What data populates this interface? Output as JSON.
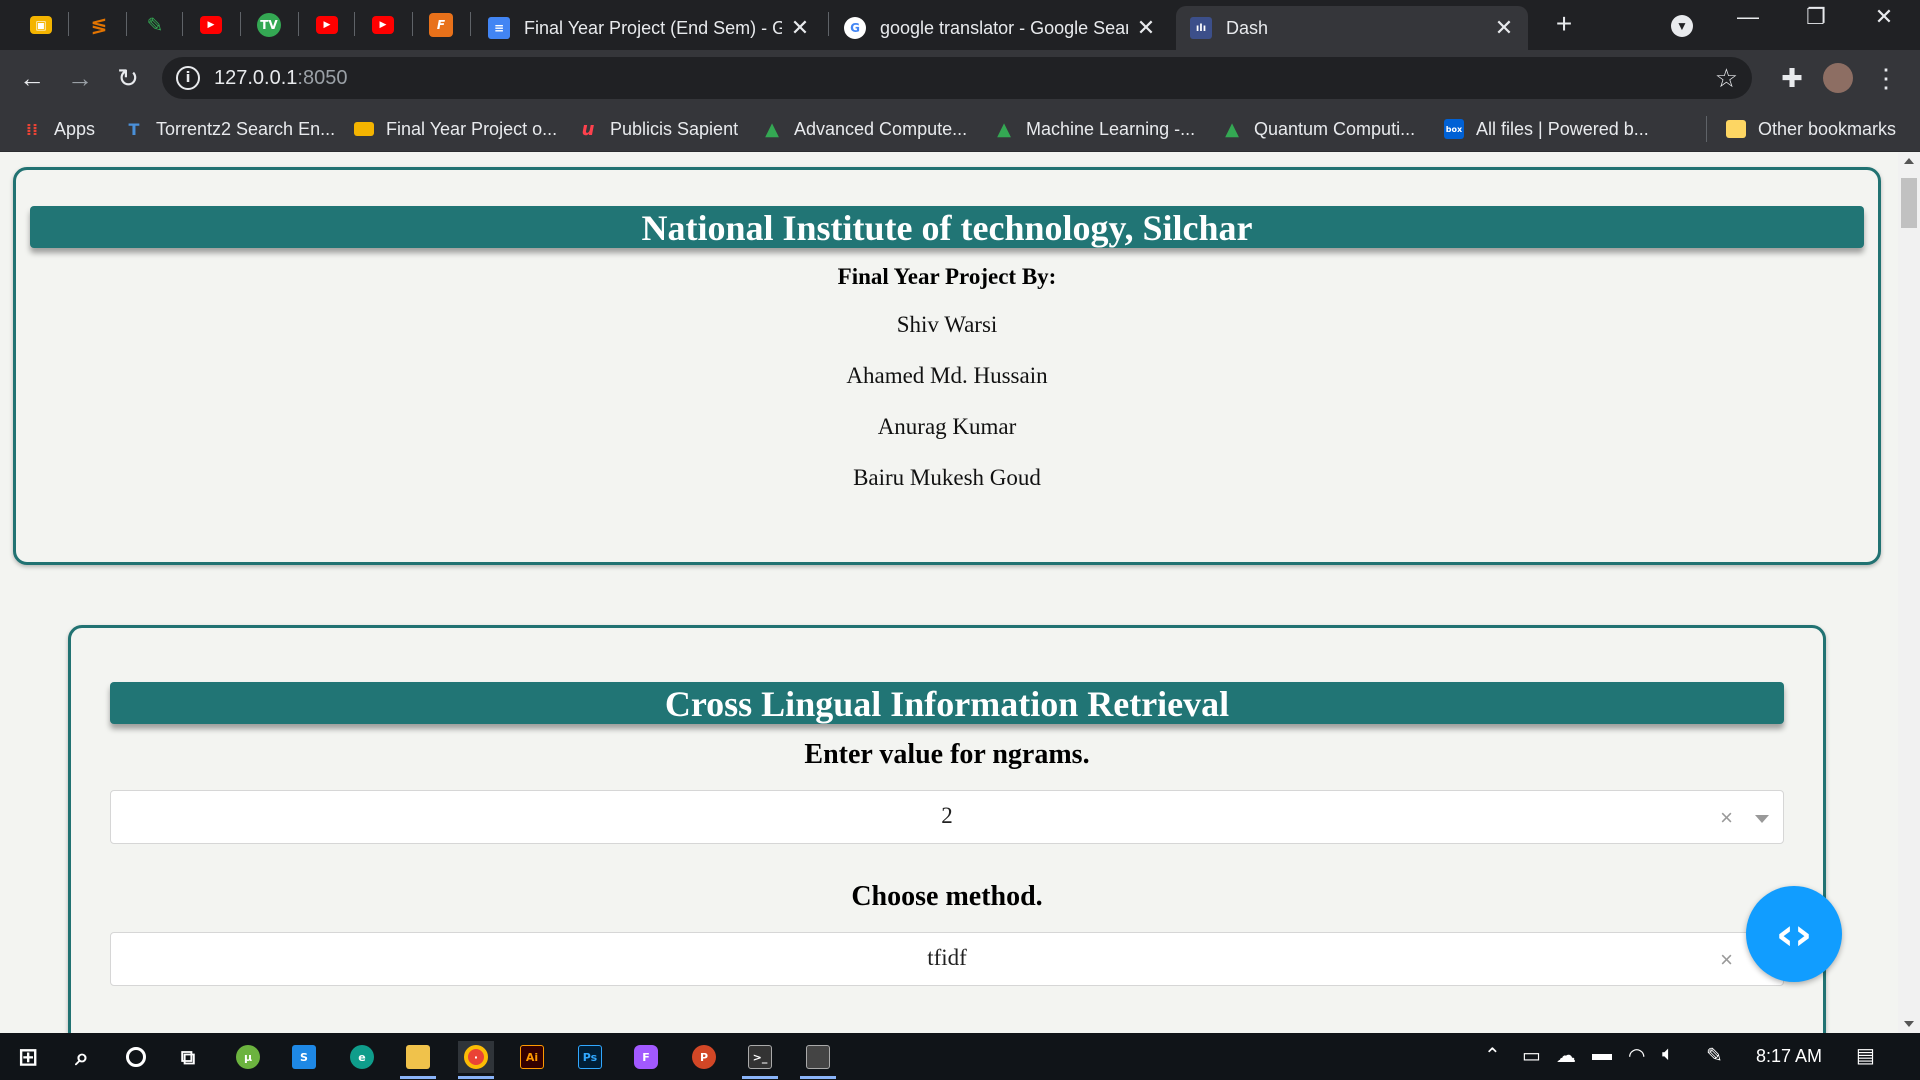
{
  "browser": {
    "pinned_tabs": [
      {
        "icon": "google-classroom-icon",
        "color": "#f4b400"
      },
      {
        "icon": "tempo-app-icon",
        "color": "#e37400"
      },
      {
        "icon": "feather-app-icon",
        "color": "#34a853"
      },
      {
        "icon": "youtube-icon",
        "color": "#ff0000"
      },
      {
        "icon": "tv-app-icon",
        "color": "#34a853"
      },
      {
        "icon": "youtube-icon",
        "color": "#ff0000"
      },
      {
        "icon": "youtube-icon",
        "color": "#ff0000"
      },
      {
        "icon": "fiverr-f-icon",
        "color": "#e8711a"
      }
    ],
    "tabs": [
      {
        "title": "Final Year Project (End Sem) - Go",
        "icon": "google-docs-icon",
        "close": "✕"
      },
      {
        "title": "google translator - Google Searc",
        "icon": "google-g-icon",
        "close": "✕"
      },
      {
        "title": "Dash",
        "icon": "dash-plotly-icon",
        "close": "✕",
        "active": true
      }
    ],
    "new_tab": "+",
    "window_controls": {
      "minimize": "—",
      "restore": "❐",
      "close": "✕"
    },
    "url_host": "127.0.0.1",
    "url_port": ":8050",
    "bookmarks": [
      {
        "label": "Apps",
        "icon": "apps-grid-icon"
      },
      {
        "label": "Torrentz2 Search En...",
        "icon": "torrentz-icon"
      },
      {
        "label": "Final Year Project o...",
        "icon": "google-slides-icon"
      },
      {
        "label": "Publicis Sapient",
        "icon": "publicis-sapient-icon"
      },
      {
        "label": "Advanced Compute...",
        "icon": "google-drive-icon"
      },
      {
        "label": "Machine Learning -...",
        "icon": "google-drive-icon"
      },
      {
        "label": "Quantum Computi...",
        "icon": "google-drive-icon"
      },
      {
        "label": "All files | Powered b...",
        "icon": "box-icon"
      }
    ],
    "other_bookmarks": "Other bookmarks"
  },
  "header_card": {
    "title": "National Institute of technology, Silchar",
    "subtitle": "Final Year Project By:",
    "members": [
      "Shiv Warsi",
      "Ahamed Md. Hussain",
      "Anurag Kumar",
      "Bairu Mukesh Goud"
    ]
  },
  "clir_card": {
    "title": "Cross Lingual Information Retrieval",
    "ngrams_label": "Enter value for ngrams.",
    "ngrams_value": "2",
    "method_label": "Choose method.",
    "method_value": "tfidf",
    "clear_symbol": "×"
  },
  "taskbar": {
    "time": "8:17 AM"
  },
  "colors": {
    "accent_teal": "#217575",
    "dev_button": "#119dff"
  }
}
